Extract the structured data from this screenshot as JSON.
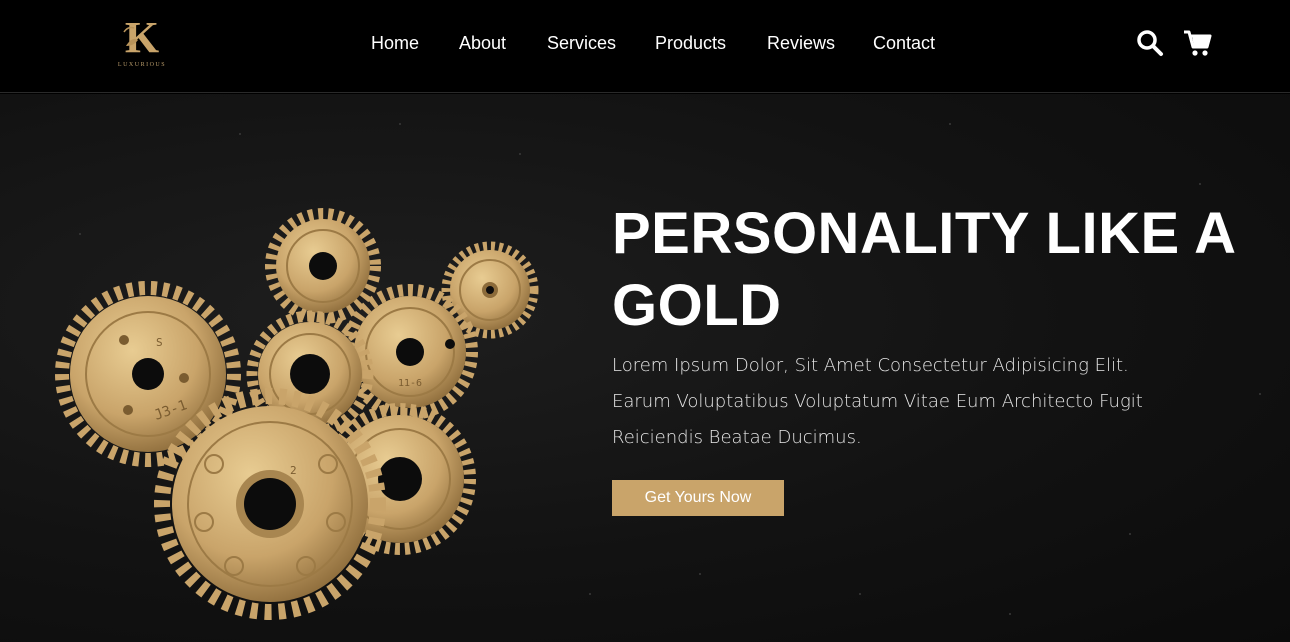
{
  "brand": {
    "logo_letter": "K",
    "wordmark": "LUXURIOUS",
    "gold": "#c9a46a",
    "background": "#000000"
  },
  "nav": {
    "links": [
      {
        "label": "Home"
      },
      {
        "label": "About"
      },
      {
        "label": "Services"
      },
      {
        "label": "Products"
      },
      {
        "label": "Reviews"
      },
      {
        "label": "Contact"
      }
    ],
    "icons": [
      "search-icon",
      "cart-icon"
    ]
  },
  "hero": {
    "title": "PERSONALITY LIKE A GOLD",
    "body": "Lorem Ipsum Dolor, Sit Amet Consectetur Adipisicing Elit. Earum Voluptatibus Voluptatum Vitae Eum Architecto Fugit Reiciendis Beatae Ducimus.",
    "cta_label": "Get Yours Now",
    "image": "gold-gears-image",
    "gear_markings": [
      "S",
      "J3-1",
      "11-6",
      "2"
    ]
  }
}
